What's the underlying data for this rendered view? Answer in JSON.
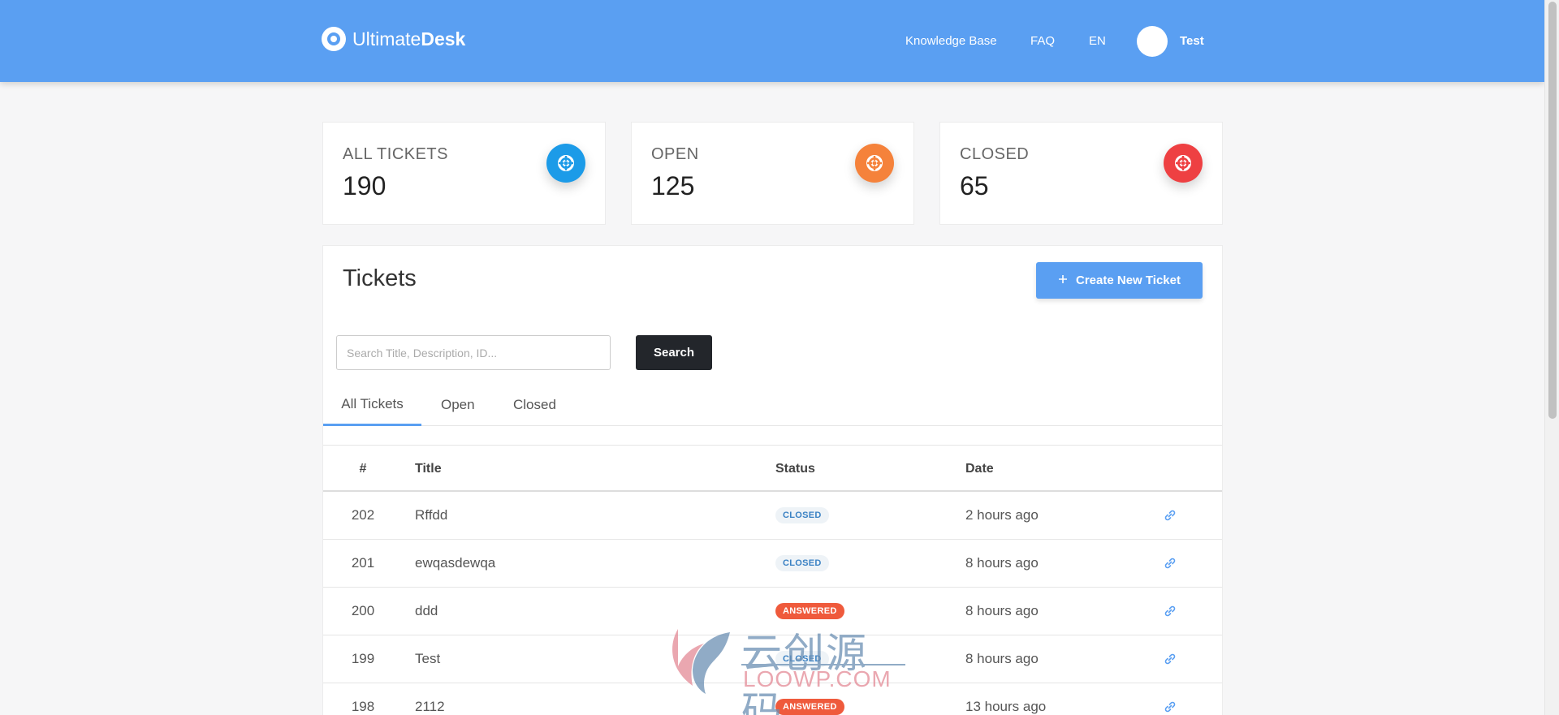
{
  "header": {
    "brand_light": "Ultimate",
    "brand_bold": "Desk",
    "nav": {
      "knowledge_base": "Knowledge Base",
      "faq": "FAQ",
      "lang": "EN"
    },
    "user_name": "Test"
  },
  "stats": [
    {
      "label": "ALL TICKETS",
      "value": "190",
      "color": "#1c9be8"
    },
    {
      "label": "OPEN",
      "value": "125",
      "color": "#f5823b"
    },
    {
      "label": "CLOSED",
      "value": "65",
      "color": "#ee4042"
    }
  ],
  "tickets": {
    "title": "Tickets",
    "create_label": "Create New Ticket",
    "search_placeholder": "Search Title, Description, ID...",
    "search_label": "Search",
    "tabs": [
      "All Tickets",
      "Open",
      "Closed"
    ],
    "columns": {
      "id": "#",
      "title": "Title",
      "status": "Status",
      "date": "Date"
    },
    "rows": [
      {
        "id": "202",
        "title": "Rffdd",
        "status": "CLOSED",
        "date": "2 hours ago"
      },
      {
        "id": "201",
        "title": "ewqasdewqa",
        "status": "CLOSED",
        "date": "8 hours ago"
      },
      {
        "id": "200",
        "title": "ddd",
        "status": "ANSWERED",
        "date": "8 hours ago"
      },
      {
        "id": "199",
        "title": "Test",
        "status": "CLOSED",
        "date": "8 hours ago"
      },
      {
        "id": "198",
        "title": "2112",
        "status": "ANSWERED",
        "date": "13 hours ago"
      }
    ]
  },
  "watermark": {
    "cn": "云创源码",
    "en": "LOOWP.COM"
  },
  "colors": {
    "accent": "#5a9ff2",
    "dark_button": "#23262b",
    "answered": "#ef5a3c"
  }
}
